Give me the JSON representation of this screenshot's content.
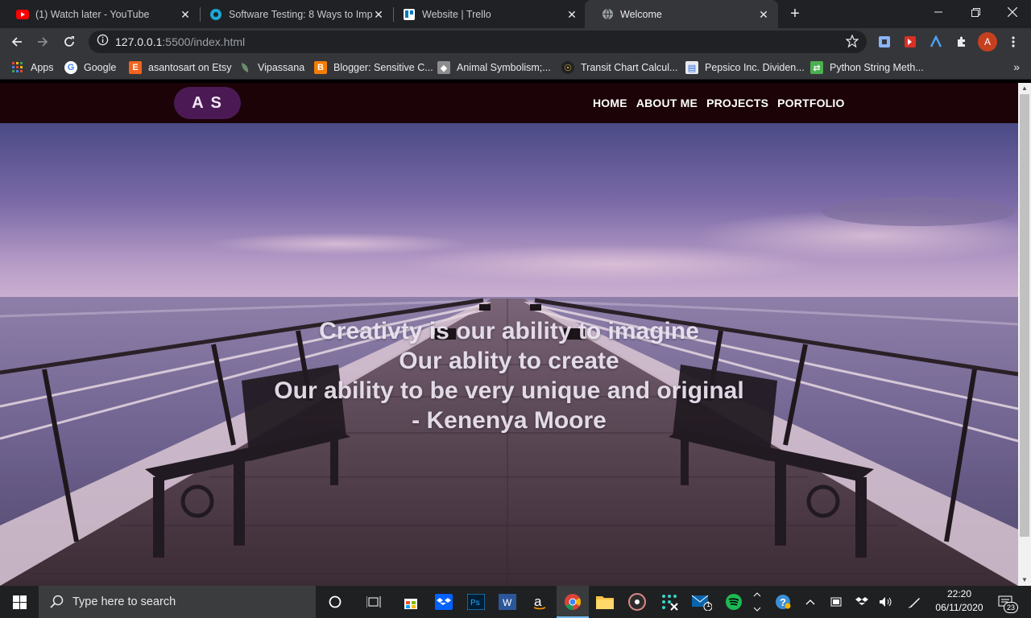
{
  "browser": {
    "tabs": [
      {
        "title": "(1) Watch later - YouTube",
        "favicon": "youtube-icon",
        "active": false
      },
      {
        "title": "Software Testing: 8 Ways to Impr",
        "favicon": "testing-site-icon",
        "active": false
      },
      {
        "title": "Website | Trello",
        "favicon": "trello-icon",
        "active": false
      },
      {
        "title": "Welcome",
        "favicon": "globe-icon",
        "active": true
      }
    ],
    "url_host": "127.0.0.1",
    "url_path": ":5500/index.html",
    "bookmarks": [
      {
        "label": "Apps",
        "icon": "apps-grid-icon"
      },
      {
        "label": "Google",
        "icon": "google-icon"
      },
      {
        "label": "asantosart on Etsy",
        "icon": "etsy-icon"
      },
      {
        "label": "Vipassana",
        "icon": "vipassana-icon"
      },
      {
        "label": "Blogger: Sensitive C...",
        "icon": "blogger-icon"
      },
      {
        "label": "Animal Symbolism;...",
        "icon": "animal-icon"
      },
      {
        "label": "Transit Chart Calcul...",
        "icon": "transit-icon"
      },
      {
        "label": "Pepsico Inc. Dividen...",
        "icon": "pepsico-icon"
      },
      {
        "label": "Python String Meth...",
        "icon": "python-icon"
      }
    ],
    "profile_initial": "A"
  },
  "site": {
    "logo": "A S",
    "nav": [
      "HOME",
      "ABOUT ME",
      "PROJECTS",
      "PORTFOLIO"
    ],
    "quote": [
      "Creativty is our ability to imagine",
      "Our ablity to create",
      "Our ability to be very unique and original",
      "- Kenenya Moore"
    ]
  },
  "taskbar": {
    "search_placeholder": "Type here to search",
    "time": "22:20",
    "date": "06/11/2020",
    "mail_badge": "1",
    "notification_count": "23"
  },
  "colors": {
    "nav_bg": "#1b0307",
    "logo_bg": "#4b1a55",
    "accent": "#76b9ed"
  }
}
